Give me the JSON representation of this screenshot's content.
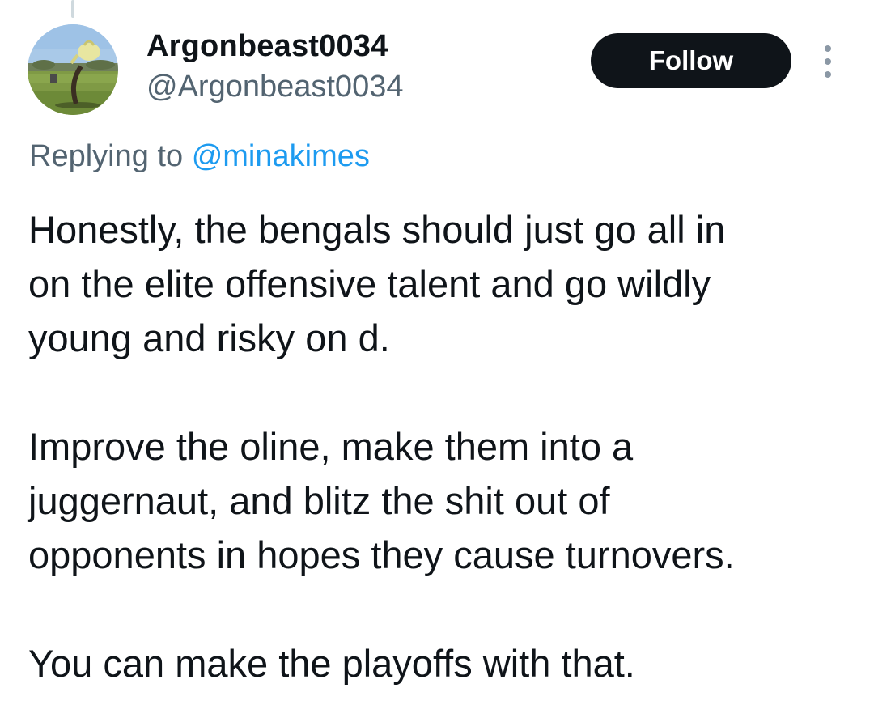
{
  "tweet": {
    "author": {
      "display_name": "Argonbeast0034",
      "handle": "@Argonbeast0034",
      "avatar_icon": "profile-picture"
    },
    "follow_label": "Follow",
    "more_icon": "more-vertical-icon",
    "replying_prefix": "Replying to",
    "replying_to": "@minakimes",
    "paragraphs": [
      "Honestly, the bengals should just go all in\non the elite offensive talent and go wildly\nyoung and risky on d.",
      "Improve the oline, make them into a\njuggernaut, and blitz the shit out of\nopponents in hopes they cause turnovers.",
      "You can make the playoffs with that."
    ]
  },
  "colors": {
    "primary_text": "#0f1419",
    "secondary_text": "#536471",
    "link": "#1d9bf0",
    "follow_bg": "#0f1419",
    "follow_text": "#ffffff"
  }
}
